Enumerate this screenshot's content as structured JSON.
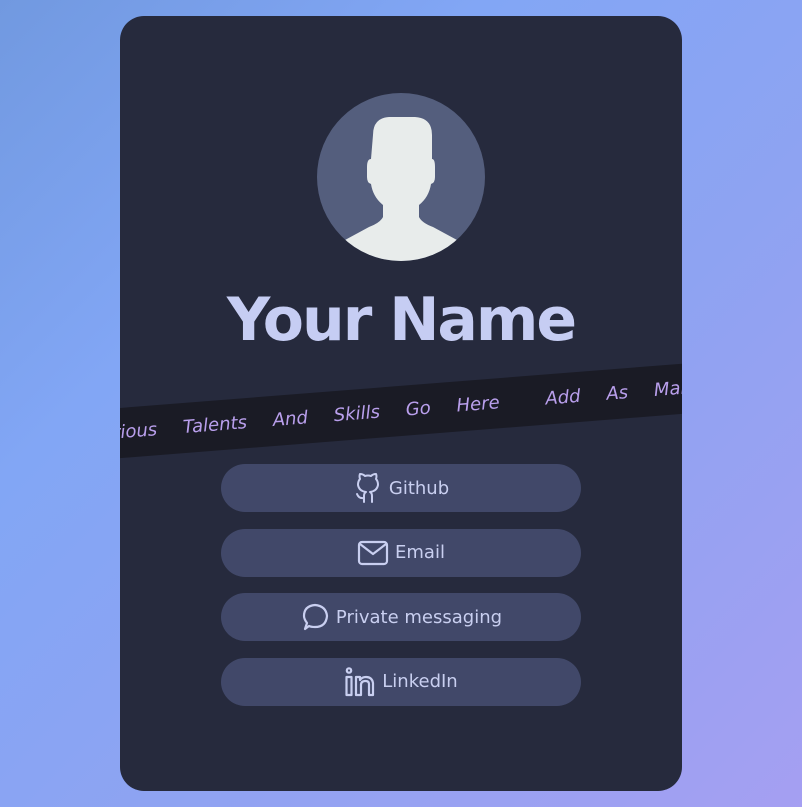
{
  "profile": {
    "name": "Your Name"
  },
  "ticker": {
    "words": [
      "Various",
      "Talents",
      "And",
      "Skills",
      "Go",
      "Here",
      "Add",
      "As",
      "Many",
      "As"
    ]
  },
  "links": [
    {
      "label": "Github",
      "icon": "github-icon"
    },
    {
      "label": "Email",
      "icon": "mail-icon"
    },
    {
      "label": "Private messaging",
      "icon": "chat-bubble-icon"
    },
    {
      "label": "LinkedIn",
      "icon": "linkedin-icon"
    }
  ],
  "colors": {
    "card": "#262a3d",
    "button": "#414869",
    "name": "#c6cdf3",
    "ticker_text": "#b99fec",
    "ticker_band": "#1a1b25"
  }
}
